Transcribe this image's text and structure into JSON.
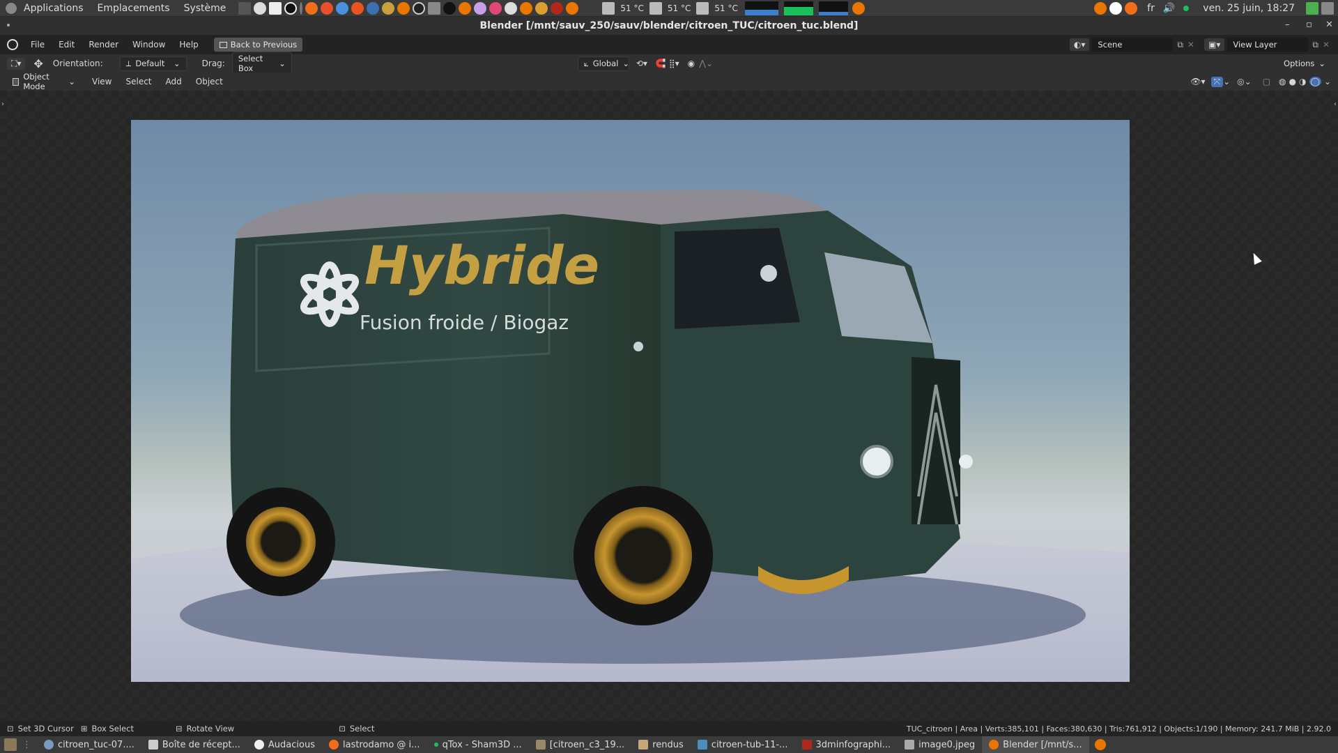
{
  "panel": {
    "menus": [
      "Applications",
      "Emplacements",
      "Système"
    ],
    "temps": [
      "51 °C",
      "51 °C",
      "51 °C"
    ],
    "lang": "fr",
    "clock": "ven. 25 juin, 18:27"
  },
  "window": {
    "title": "Blender [/mnt/sauv_250/sauv/blender/citroen_TUC/citroen_tuc.blend]"
  },
  "topbar": {
    "menus": [
      "File",
      "Edit",
      "Render",
      "Window",
      "Help"
    ],
    "back_button": "Back to Previous",
    "scene": "Scene",
    "view_layer": "View Layer"
  },
  "toolheader": {
    "orientation_label": "Orientation:",
    "orientation_value": "Default",
    "drag_label": "Drag:",
    "drag_value": "Select Box",
    "transform": "Global",
    "options": "Options"
  },
  "vpheader": {
    "mode": "Object Mode",
    "menus": [
      "View",
      "Select",
      "Add",
      "Object"
    ]
  },
  "render": {
    "brand": "Hybride",
    "tagline": "Fusion froide / Biogaz"
  },
  "statusbar": {
    "hints": [
      "Set 3D Cursor",
      "Box Select",
      "Rotate View",
      "Select"
    ],
    "stats": "TUC_citroen | Area | Verts:385,101 | Faces:380,630 | Tris:761,912 | Objects:1/190 | Memory: 241.7 MiB | 2.92.0"
  },
  "taskbar": {
    "tasks": [
      "citroen_tuc-07....",
      "Boîte de récept...",
      "Audacious",
      "lastrodamo @ i...",
      "qTox - Sham3D ...",
      "[citroen_c3_19...",
      "rendus",
      "citroen-tub-11-...",
      "3dminfographi...",
      "image0.jpeg",
      "Blender [/mnt/s..."
    ]
  },
  "colors": {
    "accent": "#5680c2",
    "van_body": "#2f4440",
    "wheel_gold": "#c7952e"
  }
}
